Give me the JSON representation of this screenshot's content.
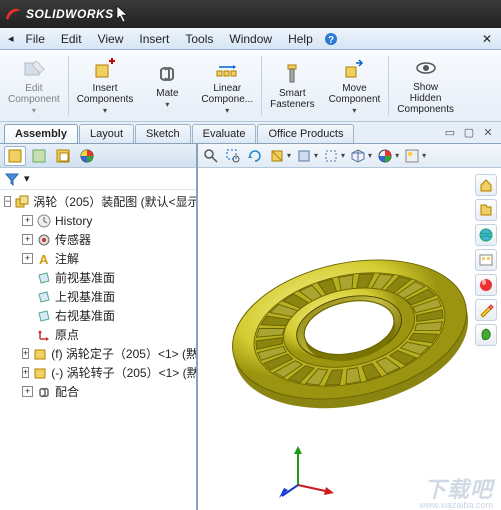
{
  "app": {
    "name": "SOLIDWORKS"
  },
  "menu": {
    "items": [
      "File",
      "Edit",
      "View",
      "Insert",
      "Tools",
      "Window",
      "Help"
    ]
  },
  "ribbon": {
    "items": [
      {
        "key": "edit_component",
        "label": "Edit\nComponent",
        "disabled": true,
        "dropdown": true
      },
      {
        "key": "insert_components",
        "label": "Insert\nComponents",
        "dropdown": true
      },
      {
        "key": "mate",
        "label": "Mate",
        "dropdown": true
      },
      {
        "key": "linear_comp",
        "label": "Linear\nCompone...",
        "dropdown": true
      },
      {
        "key": "smart_fasteners",
        "label": "Smart\nFasteners"
      },
      {
        "key": "move_component",
        "label": "Move\nComponent",
        "dropdown": true
      },
      {
        "key": "show_hidden",
        "label": "Show\nHidden\nComponents"
      }
    ]
  },
  "tabs": {
    "items": [
      "Assembly",
      "Layout",
      "Sketch",
      "Evaluate",
      "Office Products"
    ],
    "active": 0
  },
  "side": {
    "filter_hint": "",
    "tree": {
      "root": "涡轮（205）装配图  (默认<显示",
      "nodes": [
        {
          "icon": "history",
          "label": "History",
          "expand": "+"
        },
        {
          "icon": "sensor",
          "label": "传感器",
          "expand": "+"
        },
        {
          "icon": "annotation",
          "label": "注解",
          "expand": "+",
          "color": "#d0a010"
        },
        {
          "icon": "plane",
          "label": "前视基准面"
        },
        {
          "icon": "plane",
          "label": "上视基准面"
        },
        {
          "icon": "plane",
          "label": "右视基准面"
        },
        {
          "icon": "origin",
          "label": "原点"
        },
        {
          "icon": "part",
          "label": "(f) 涡轮定子（205）<1> (黙",
          "expand": "+",
          "color": "#d0a010"
        },
        {
          "icon": "part",
          "label": "(-) 涡轮转子（205）<1> (黙",
          "expand": "+",
          "color": "#d0a010"
        },
        {
          "icon": "mate",
          "label": "配合",
          "expand": "+"
        }
      ]
    }
  },
  "viewport": {
    "toolbar_icons": [
      "zoom-fit",
      "zoom-area",
      "rotate",
      "pan",
      "section",
      "display-style",
      "hidden-lines",
      "perspective",
      "appearance",
      "scene",
      "render",
      "decal"
    ],
    "right_icons": [
      "home",
      "zoom",
      "globe",
      "draft",
      "shadow",
      "pencil",
      "leaf"
    ]
  },
  "watermark": {
    "main": "下载吧",
    "url": "www.xiazaiba.com"
  }
}
